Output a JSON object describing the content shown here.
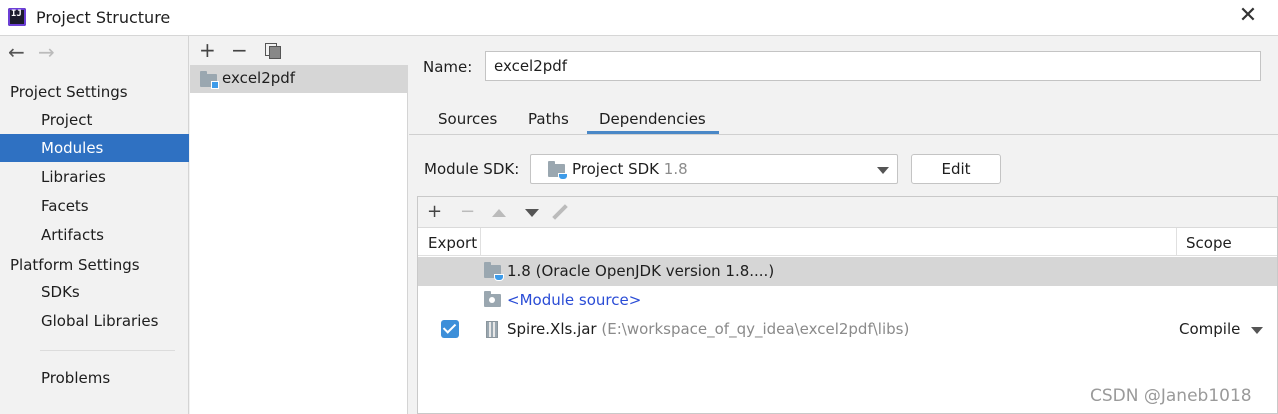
{
  "window": {
    "title": "Project Structure",
    "close_glyph": "✕"
  },
  "nav": {
    "back": "←",
    "forward": "→"
  },
  "sidebar": {
    "project_settings": "Project Settings",
    "items": [
      {
        "label": "Project"
      },
      {
        "label": "Modules",
        "selected": true
      },
      {
        "label": "Libraries"
      },
      {
        "label": "Facets"
      },
      {
        "label": "Artifacts"
      }
    ],
    "platform_settings": "Platform Settings",
    "platform_items": [
      {
        "label": "SDKs"
      },
      {
        "label": "Global Libraries"
      }
    ],
    "problems": "Problems"
  },
  "modules": {
    "toolbar": {
      "add": "+",
      "remove": "−"
    },
    "items": [
      {
        "label": "excel2pdf",
        "selected": true
      }
    ]
  },
  "main": {
    "name_label": "Name:",
    "name_value": "excel2pdf",
    "tabs": [
      {
        "label": "Sources"
      },
      {
        "label": "Paths"
      },
      {
        "label": "Dependencies",
        "active": true
      }
    ],
    "sdk_label": "Module SDK:",
    "sdk_value": "Project SDK",
    "sdk_version": "1.8",
    "edit_button": "Edit"
  },
  "dependencies": {
    "toolbar": {
      "add": "+",
      "remove": "−"
    },
    "columns": {
      "export": "Export",
      "scope": "Scope"
    },
    "rows": [
      {
        "name": "1.8 (Oracle OpenJDK version 1.8....)",
        "selected": true
      },
      {
        "name": "<Module source>"
      },
      {
        "name": "Spire.Xls.jar",
        "path": "(E:\\workspace_of_qy_idea\\excel2pdf\\libs)",
        "export": true,
        "scope": "Compile"
      }
    ]
  },
  "watermark": "CSDN @Janeb1018",
  "colors": {
    "selection": "#2f71c2",
    "link": "#2a4cd6",
    "tab_underline": "#4a88c7"
  }
}
